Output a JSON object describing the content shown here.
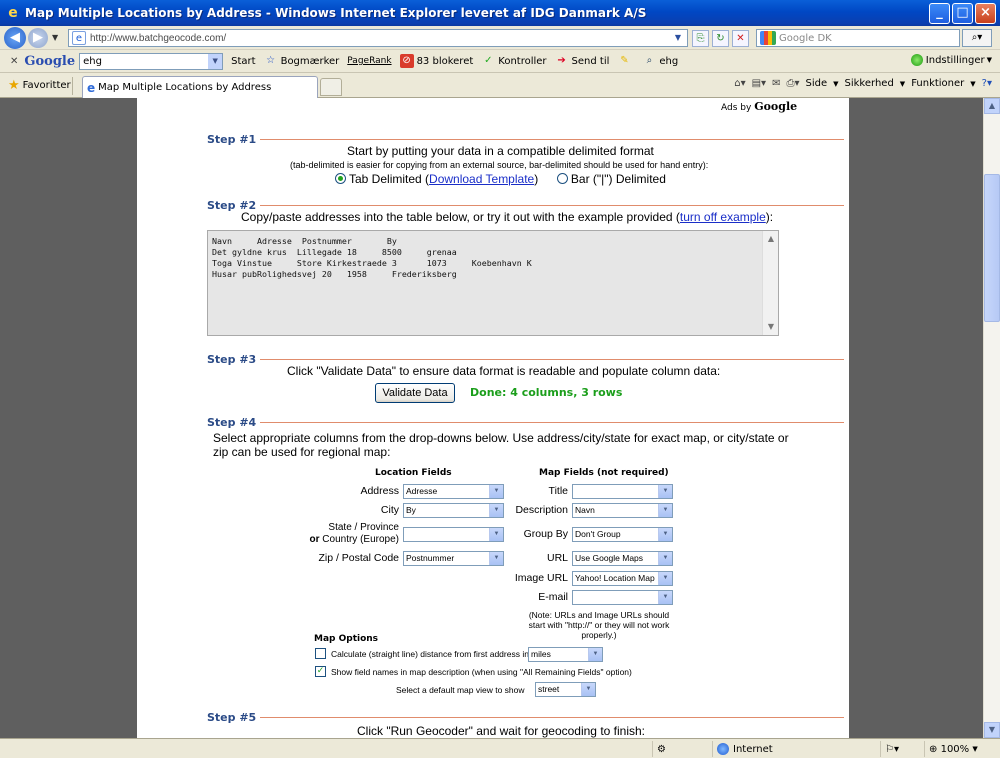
{
  "window": {
    "title": "Map Multiple Locations by Address - Windows Internet Explorer leveret af IDG Danmark A/S"
  },
  "address_bar": {
    "url": "http://www.batchgeocode.com/",
    "search_placeholder": "Google DK"
  },
  "google_toolbar": {
    "query": "ehg",
    "items": [
      "Start",
      "Bogmærker",
      "PageRank",
      "83 blokeret",
      "Kontroller",
      "Send til",
      "ehg"
    ],
    "settings_label": "Indstillinger"
  },
  "favorites": {
    "label": "Favoritter",
    "tab_label": "Map Multiple Locations by Address",
    "commands": [
      "Side",
      "Sikkerhed",
      "Funktioner"
    ]
  },
  "ads": {
    "ads_by": "Ads by",
    "brand": "Google"
  },
  "step1": {
    "label": "Step #1",
    "instruction": "Start by putting your data in a compatible delimited format",
    "note": "(tab-delimited is easier for copying from an external source, bar-delimited should be used for hand entry):",
    "option_tab_pre": "Tab Delimited (",
    "option_tab_link": "Download Template",
    "option_tab_post": ")",
    "option_bar": "Bar (\"|\") Delimited"
  },
  "step2": {
    "label": "Step #2",
    "instruction_pre": "Copy/paste addresses into the table below, or try it out with the example provided (",
    "instruction_link": "turn off example",
    "instruction_post": "):",
    "data_text": "Navn     Adresse  Postnummer       By\nDet gyldne krus  Lillegade 18     8500     grenaa\nToga Vinstue     Store Kirkestraede 3      1073     Koebenhavn K\nHusar pubRolighedsvej 20   1958     Frederiksberg"
  },
  "step3": {
    "label": "Step #3",
    "instruction": "Click \"Validate Data\" to ensure data format is readable and populate column data:",
    "button": "Validate Data",
    "status": "Done: 4 columns, 3 rows"
  },
  "step4": {
    "label": "Step #4",
    "instruction_line1": "Select appropriate columns from the drop-downs below. Use address/city/state for exact map, or city/state or",
    "instruction_line2": "zip can be used for regional map:",
    "location_header": "Location Fields",
    "map_header": "Map Fields (not required)",
    "location_fields": [
      {
        "label": "Address",
        "value": "Adresse"
      },
      {
        "label": "City",
        "value": "By"
      },
      {
        "label_line1": "State / Province",
        "label_or": "or",
        "label_line2": "Country (Europe)",
        "value": ""
      },
      {
        "label": "Zip / Postal Code",
        "value": "Postnummer"
      }
    ],
    "map_fields": [
      {
        "label": "Title",
        "value": ""
      },
      {
        "label": "Description",
        "value": "Navn"
      },
      {
        "label": "Group By",
        "value": "Don't Group"
      },
      {
        "label": "URL",
        "value": "Use Google Maps"
      },
      {
        "label": "Image URL",
        "value": "Yahoo! Location Map"
      },
      {
        "label": "E-mail",
        "value": ""
      }
    ],
    "url_note_1": "(Note: URLs and Image URLs should",
    "url_note_2": "start with \"http://\" or they will not work",
    "url_note_3": "properly.)",
    "map_options_header": "Map Options",
    "option_distance": "Calculate (straight line) distance from first address in",
    "distance_unit": "miles",
    "option_field_names": "Show field names in map description (when using \"All Remaining Fields\" option)",
    "default_view_label": "Select a default map view to show",
    "default_view_value": "street"
  },
  "step5": {
    "label": "Step #5",
    "instruction": "Click \"Run Geocoder\" and wait for geocoding to finish:"
  },
  "status_bar": {
    "zone": "Internet",
    "zoom": "100%"
  }
}
